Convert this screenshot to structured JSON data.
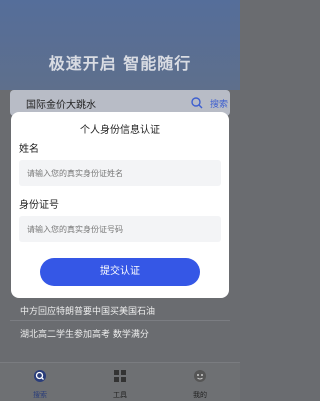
{
  "header": {
    "slogan": "极速开启 智能随行"
  },
  "search": {
    "query": "国际金价大跳水",
    "button_label": "搜索"
  },
  "news": {
    "items": [
      "中方回应特朗普要中国买美国石油",
      "湖北高二学生参加高考 数学满分"
    ]
  },
  "modal": {
    "title": "个人身份信息认证",
    "name_label": "姓名",
    "name_placeholder": "请输入您的真实身份证姓名",
    "id_label": "身份证号",
    "id_placeholder": "请输入您的真实身份证号码",
    "submit_label": "提交认证"
  },
  "tabbar": {
    "tabs": [
      {
        "label": "搜索",
        "icon": "search-icon",
        "active": true
      },
      {
        "label": "工具",
        "icon": "tools-grid-icon",
        "active": false
      },
      {
        "label": "我的",
        "icon": "profile-icon",
        "active": false
      }
    ]
  },
  "colors": {
    "accent": "#3557e6",
    "overlay": "#6a6c70"
  }
}
